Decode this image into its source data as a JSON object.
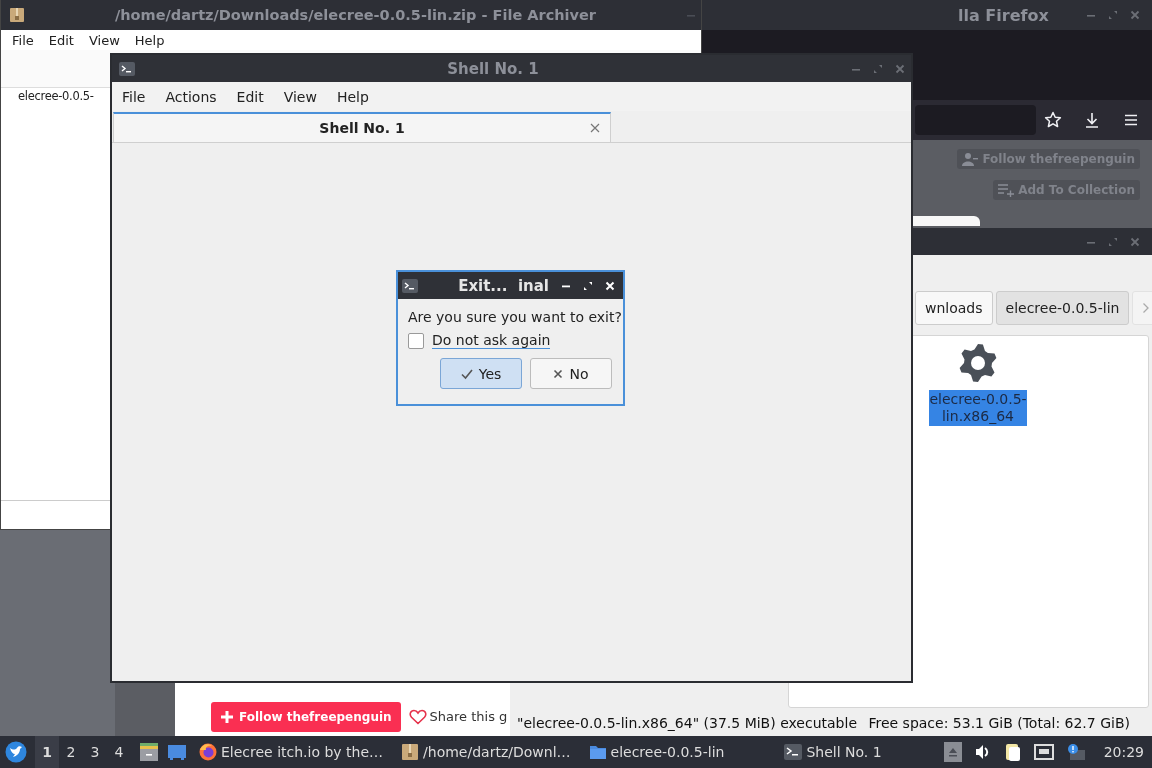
{
  "file_archiver": {
    "title": "/home/dartz/Downloads/elecree-0.0.5-lin.zip - File Archiver",
    "menu": [
      "File",
      "Edit",
      "View",
      "Help"
    ],
    "items": [
      "elecree-0.0.5-"
    ]
  },
  "firefox": {
    "title": "lla Firefox",
    "page_buttons": [
      {
        "label": "Follow thefreepenguin",
        "kind": "follow"
      },
      {
        "label": "Add To Collection",
        "kind": "collection"
      }
    ],
    "follow_button": "Follow thefreepenguin",
    "share_link": "Share this g"
  },
  "file_manager": {
    "breadcrumbs": [
      {
        "label": "wnloads",
        "selected": false
      },
      {
        "label": "elecree-0.0.5-lin",
        "selected": true
      }
    ],
    "files": [
      {
        "name": "elecree-0.0.5-lin.x86_64",
        "selected": true
      }
    ],
    "status_left": "\"elecree-0.0.5-lin.x86_64\" (37.5 MiB) executable",
    "status_right": "Free space: 53.1 GiB (Total: 62.7 GiB)"
  },
  "shell": {
    "title": "Shell No. 1",
    "menu": [
      "File",
      "Actions",
      "Edit",
      "View",
      "Help"
    ],
    "tabs": [
      {
        "label": "Shell No. 1",
        "selected": true
      }
    ]
  },
  "dialog": {
    "title": "Exit...  inal",
    "message": "Are you sure you want to exit?",
    "checkbox": {
      "label": "Do not ask again",
      "checked": false
    },
    "buttons": [
      {
        "label": "Yes",
        "kind": "yes",
        "selected": true
      },
      {
        "label": "No",
        "kind": "no",
        "selected": false
      }
    ]
  },
  "taskbar": {
    "workspaces": [
      {
        "label": "1",
        "selected": true
      },
      {
        "label": "2",
        "selected": false
      },
      {
        "label": "3",
        "selected": false
      },
      {
        "label": "4",
        "selected": false
      }
    ],
    "tasks": [
      {
        "label": "Elecree itch.io by the…",
        "kind": "firefox"
      },
      {
        "label": "/home/dartz/Downl…",
        "kind": "archive"
      },
      {
        "label": "elecree-0.0.5-lin",
        "kind": "folder"
      },
      {
        "label": "Shell No. 1",
        "kind": "terminal"
      }
    ],
    "clock": "20:29"
  }
}
